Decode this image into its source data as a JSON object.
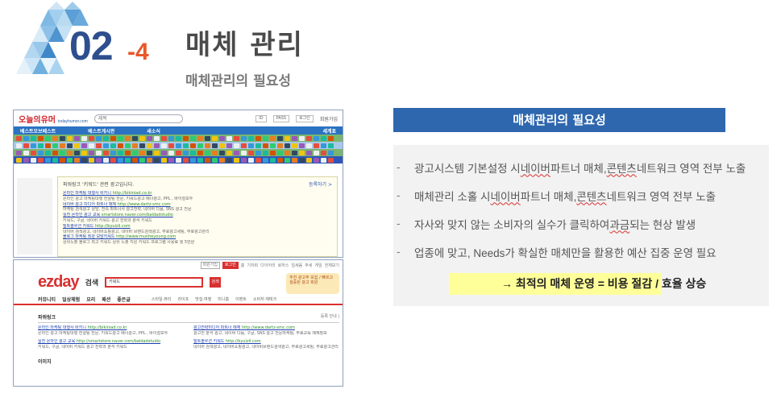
{
  "header": {
    "section_number": "02",
    "section_suffix": "-4",
    "title": "매체 관리",
    "subtitle": "매체관리의 필요성"
  },
  "screenshot1": {
    "logo": "오늘의유머",
    "logo_sub": "todayhumor.com",
    "search_placeholder": "제목",
    "top_links": [
      "ID",
      "PASS",
      "로그인",
      "회원가입"
    ],
    "nav_items": [
      "베스트오브베스트",
      "베스트게시판",
      "새소식",
      "세계표"
    ],
    "ad_header": "파워링크 '키워드' 관련 광고입니다.",
    "ad_more": "등록하기 >",
    "ads": [
      {
        "title": "온라인 마케팅 대행사 비키니",
        "url": "http://bikiniad.co.kr",
        "desc": "온라인 광고 마케팅대행 컨설팅 전문, 키워드광고 배너광고, PPL , 바이럴모두"
      },
      {
        "title": "네이버 광고 미디어 파트너 매체",
        "url": "http://www.dartz-smc.com",
        "desc": "마케팅 검색광고 상담, 전속 파트너사 광고전략, 네이버 다음, SNS 광고 전문"
      },
      {
        "title": "실전 온라인 광고 교육",
        "url": "smartstore.naver.com/baldadstudio",
        "desc": "키워드, 구글, 네이버 키워드 광고 전략과 분석 키워드"
      },
      {
        "title": "빌트솔루션 키워드",
        "url": "http://byulzil.com",
        "desc": "네이버 검색광고, 네이버쇼핑광고, 네이버 브랜드검색광고, 무료광고세팅, 무료광고관리"
      },
      {
        "title": "블로그 마케팅 최강 모담키워드",
        "url": "http://www.munheyoung.com",
        "desc": "상위노출 블로그 최고 키워드 상위 노출 지원 키워드 프로그램 사용료 월 5만원"
      }
    ]
  },
  "screenshot2": {
    "top_buttons": [
      "회원가입",
      "로그인",
      "홈",
      "기자회",
      "다이어리",
      "로하스",
      "일세움",
      "주세",
      "게임",
      "전체보기"
    ],
    "logo": "ezday",
    "logo_sub": "검색",
    "search_value": "키워드",
    "search_button": "검색",
    "promo_text": "추천 광고주 모집 / 빠르고 검증된 광고 회원",
    "menu": [
      "커뮤니티",
      "일상체험",
      "요리",
      "패션",
      "좋은글"
    ],
    "submenu": [
      "스타일·뷰티",
      "라이프",
      "맛집·여행",
      "미니홈",
      "이벤트",
      "소비자·재테크"
    ],
    "section_title": "파워링크",
    "section_more": "등록 안내 |",
    "ads_left": [
      {
        "title": "온라인 마케팅 대행사 비키니",
        "url": "http://bikiniad.co.kr",
        "desc": "온라인 광고 마케팅대행 컨설팅 전문, 키워드광고 배너광고, PPL , 바이럴모두"
      },
      {
        "title": "실전 온라인 광고 교육",
        "url": "http://smartstore.naver.com/baldadstudio",
        "desc": "키워드, 구글, 네이버 키워드 광고 전략과 분석 키워드"
      }
    ],
    "ads_right": [
      {
        "title": "광고전략미디어 파트너 매체",
        "url": "http://www.dartz-smc.com",
        "desc": "광고전 분석 광고, 네이버 다음, 구글, SNS 광고 전문마케팅, 무료교육 매체정보"
      },
      {
        "title": "빌트솔루션 키워드",
        "url": "http://byulzil.com",
        "desc": "네이버 검색광고, 네이버쇼핑광고, 네이버브랜드검색광고, 무료광고세팅, 무료광고관리"
      }
    ],
    "more_label": "이미지"
  },
  "panel": {
    "title": "매체관리의 필요성",
    "bullets": [
      {
        "pre": "광고시스템 기본설정 시 ",
        "u1": "네이버",
        "mid": " 파트너 매체, ",
        "u2": "콘텐츠",
        "post": " 네트워크 영역 전부 노출"
      },
      {
        "pre": "매체관리 소홀 시 ",
        "u1": "네이버",
        "mid": " 파트너 매체, ",
        "u2": "콘텐츠",
        "post": " 네트워크 영역 전부 노출"
      },
      {
        "pre": "자사와 맞지 않는 소비자의 실수가 클릭하여 ",
        "u1": "과금",
        "mid": " 되는 현상 발생",
        "u2": "",
        "post": ""
      },
      {
        "pre": "업종에 맞고, Needs가 확실한 매체만을 활용한 예산 집중 운영 필요",
        "u1": "",
        "mid": "",
        "u2": "",
        "post": ""
      }
    ],
    "conclusion": "→ 최적의 매체 운영  = 비용 절감 / 효율 상승"
  },
  "colors": {
    "section_blue": "#2e4f8f",
    "accent_orange": "#e9572a",
    "panel_blue": "#2e67ae",
    "highlight_yellow": "#ffff99",
    "panel_bg": "#f2f2f2"
  }
}
